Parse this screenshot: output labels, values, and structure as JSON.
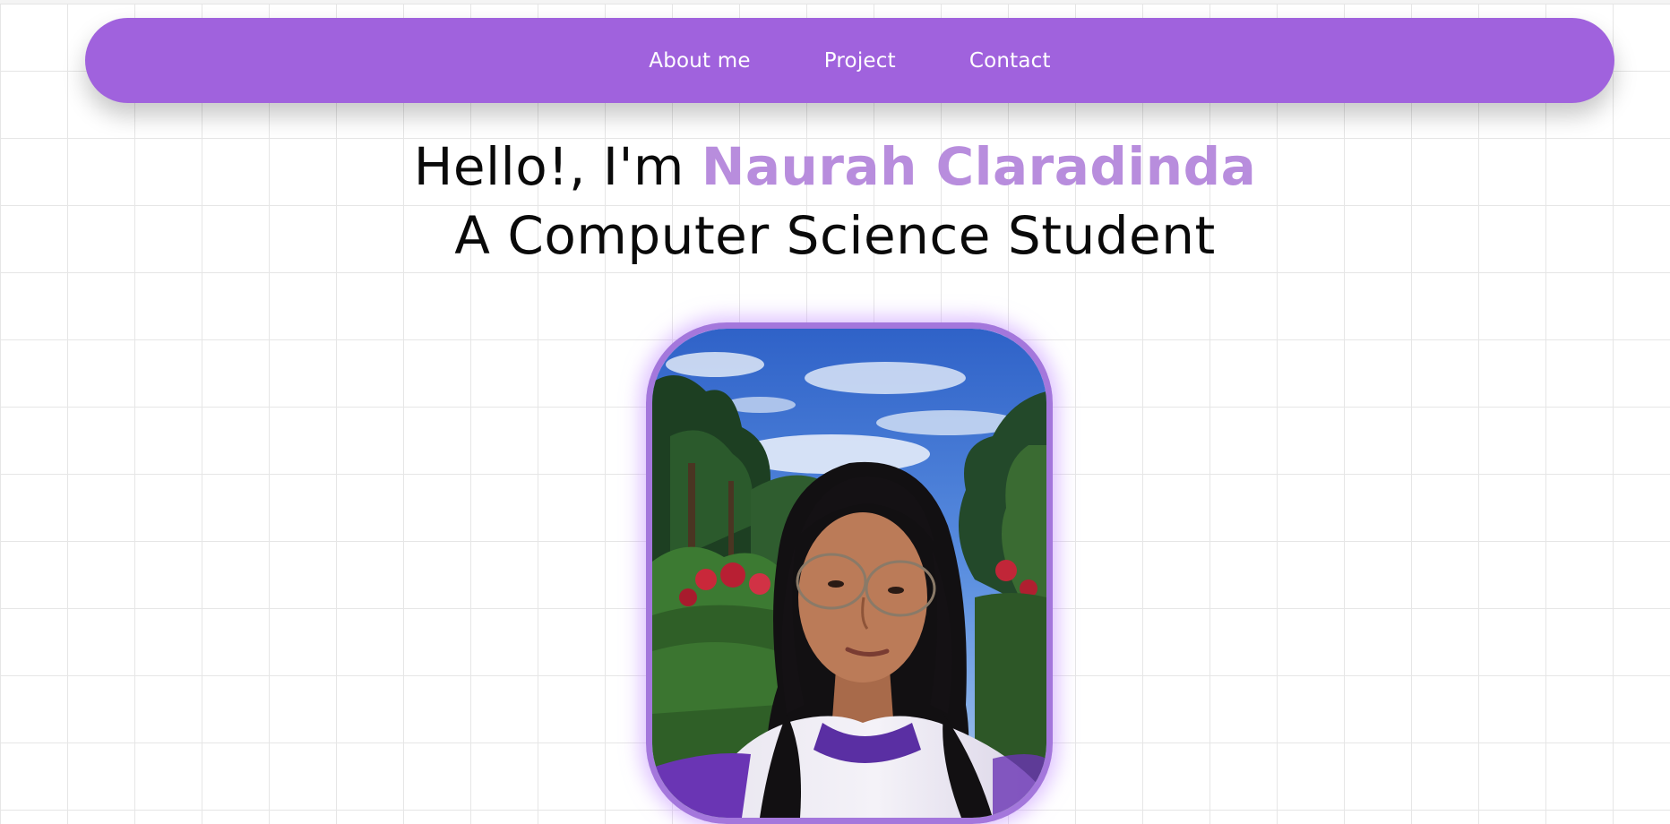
{
  "nav": {
    "links": [
      {
        "label": "About me"
      },
      {
        "label": "Project"
      },
      {
        "label": "Contact"
      }
    ]
  },
  "hero": {
    "greeting": "Hello!, I'm ",
    "name": "Naurah Claradinda",
    "subtitle": "A Computer Science Student"
  },
  "colors": {
    "navbar": "#a062dd",
    "name_accent": "#b88ddd",
    "photo_border": "#a477dc"
  }
}
